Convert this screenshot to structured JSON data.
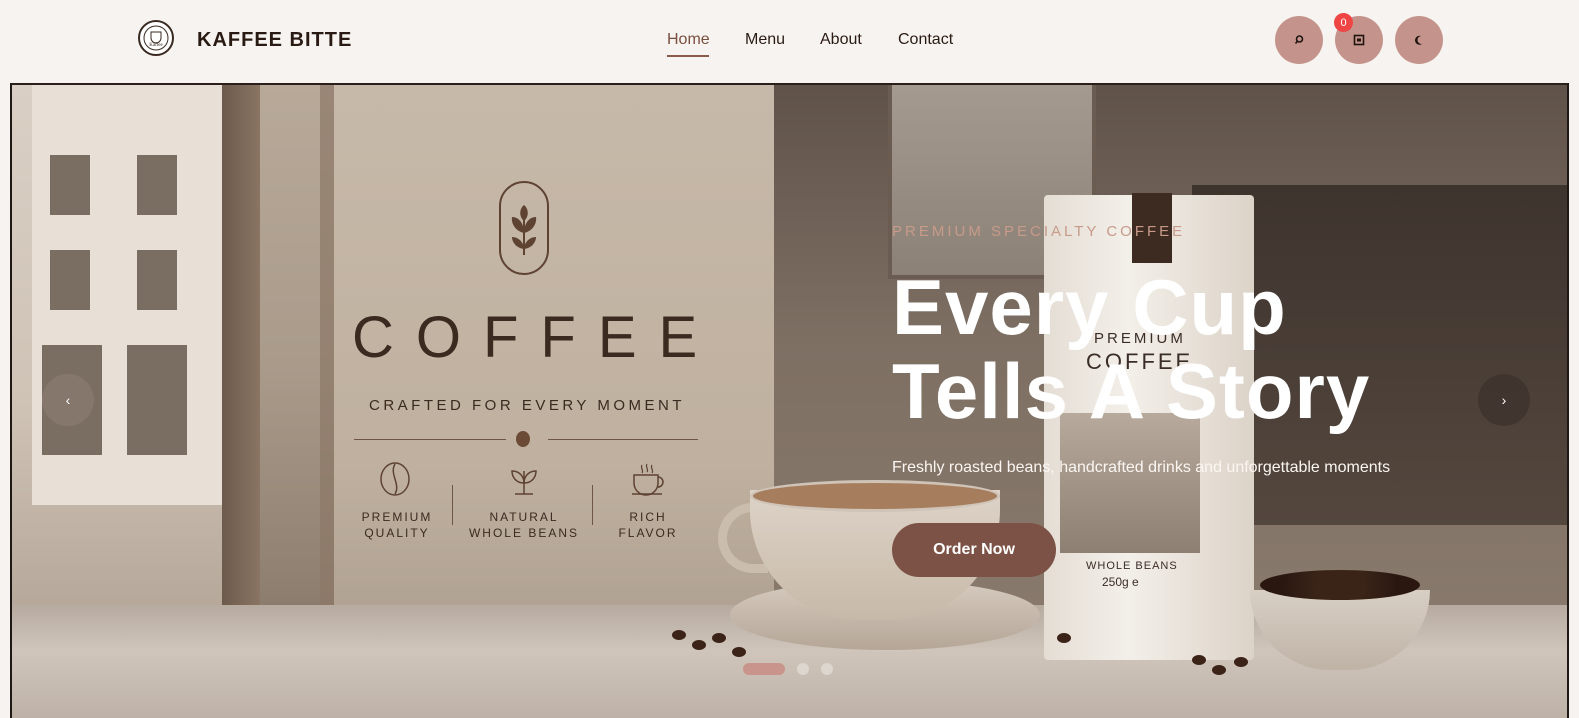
{
  "header": {
    "brand": "KAFFEE BITTE",
    "logo_text": "Kaffee",
    "nav": [
      "Home",
      "Menu",
      "About",
      "Contact"
    ],
    "active_nav": "Home",
    "icons": [
      "search-icon",
      "cart-icon",
      "moon-icon"
    ],
    "cart_count": "0"
  },
  "hero": {
    "emblem": {
      "word": "COFFEE",
      "tagline": "CRAFTED FOR EVERY MOMENT",
      "features": [
        {
          "line1": "PREMIUM",
          "line2": "QUALITY",
          "icon": "coffee-bean-icon"
        },
        {
          "line1": "NATURAL",
          "line2": "WHOLE BEANS",
          "icon": "plant-icon"
        },
        {
          "line1": "RICH",
          "line2": "FLAVOR",
          "icon": "coffee-cup-icon"
        }
      ]
    },
    "bag": {
      "line1": "PREMIUM",
      "line2": "COFFEE",
      "line3": "WHOLE BEANS",
      "line4": "250g e"
    },
    "eyebrow": "PREMIUM SPECIALTY COFFEE",
    "headline_line1": "Every Cup",
    "headline_line2": "Tells A Story",
    "subtext": "Freshly roasted beans, handcrafted drinks and unforgettable moments",
    "cta": "Order Now",
    "prev_arrow": "‹",
    "next_arrow": "›",
    "slides_count": 3,
    "active_slide": 1
  },
  "colors": {
    "accent": "#7d5246",
    "icon_button": "#c4948c",
    "badge": "#ef4545",
    "eyebrow": "#c79a8a"
  }
}
